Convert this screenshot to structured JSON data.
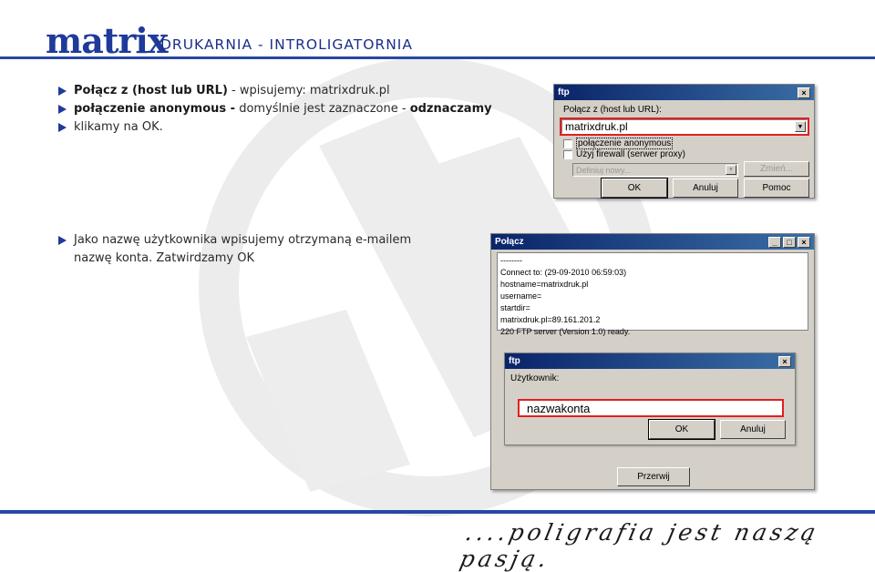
{
  "header": {
    "logo": "matrix",
    "tagline": "DRUKARNIA - INTROLIGATORNIA"
  },
  "bullets1": [
    {
      "bold": "Połącz z (host lub URL)",
      "text": " - wpisujemy: matrixdruk.pl"
    },
    {
      "bold": "połączenie anonymous -",
      "text": " domyślnie jest zaznaczone - ",
      "bold2": "odznaczamy"
    },
    {
      "text": "klikamy na OK."
    }
  ],
  "bullets2": {
    "line1": "Jako nazwę użytkownika wpisujemy otrzymaną e-mailem",
    "line2": "nazwę konta. Zatwirdzamy  OK"
  },
  "window1": {
    "title": "ftp",
    "label": "Połącz z (host lub URL):",
    "host_value": "matrixdruk.pl",
    "checkbox1": "połączenie anonymous",
    "checkbox2": "Użyj firewall (serwer proxy)",
    "proxy_placeholder": "Definiuj nowy...",
    "btn_change": "Zmień...",
    "btn_ok": "OK",
    "btn_cancel": "Anuluj",
    "btn_help": "Pomoc"
  },
  "window2": {
    "title": "Połącz",
    "log": "--------\nConnect to: (29-09-2010 06:59:03)\nhostname=matrixdruk.pl\nusername=\nstartdir=\nmatrixdruk.pl=89.161.201.2\n220 FTP server (Version 1.0) ready.",
    "btn_abort": "Przerwij"
  },
  "window3": {
    "title": "ftp",
    "label": "Użytkownik:",
    "user_value": "nazwakonta",
    "btn_ok": "OK",
    "btn_cancel": "Anuluj"
  },
  "footer": {
    "motto": "....poligrafia jest naszą pasją."
  },
  "colors": {
    "brand_blue": "#1f3a9a",
    "highlight_red": "#e02020",
    "titlebar": "#0a246a"
  }
}
